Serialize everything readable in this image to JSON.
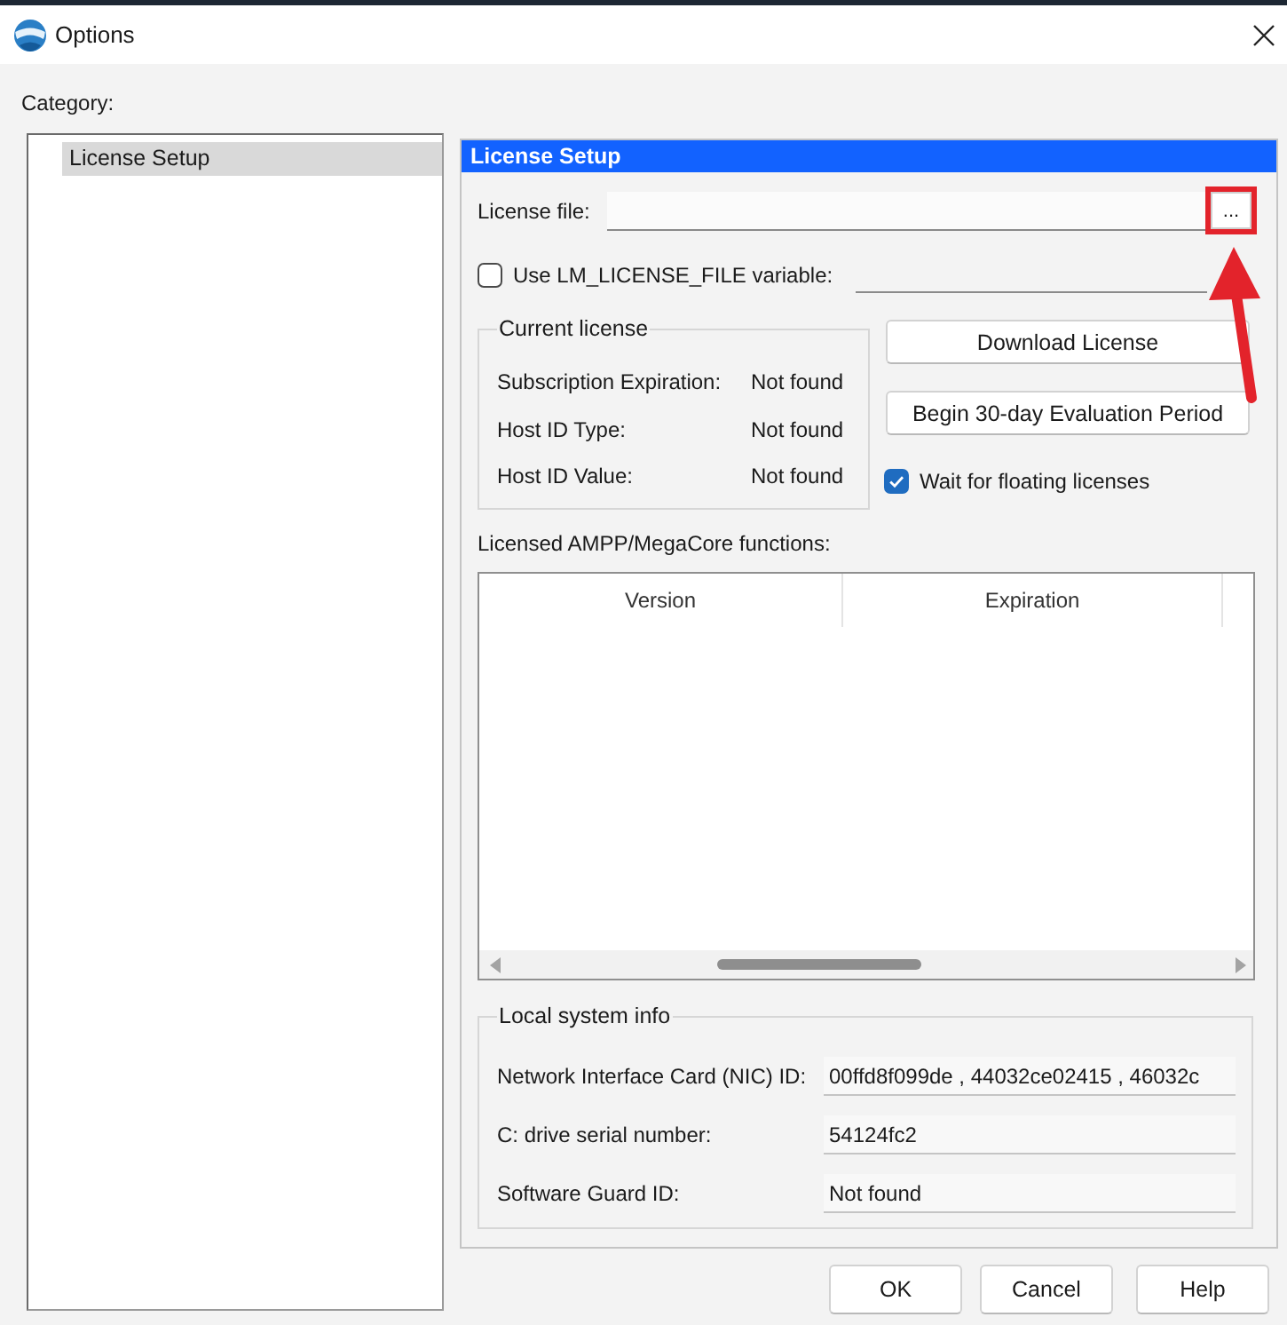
{
  "window": {
    "title": "Options"
  },
  "category": {
    "label": "Category:",
    "items": [
      {
        "label": "License Setup",
        "selected": true
      }
    ]
  },
  "panel": {
    "title": "License Setup"
  },
  "license_file": {
    "label": "License file:",
    "browse_button": {
      "label": "...",
      "highlighted": true
    }
  },
  "lm_license_variable": {
    "label": "Use LM_LICENSE_FILE variable:",
    "checked": false
  },
  "current_license": {
    "title": "Current license",
    "rows": [
      {
        "label": "Subscription Expiration:",
        "value": "Not found"
      },
      {
        "label": "Host ID Type:",
        "value": "Not found"
      },
      {
        "label": "Host ID Value:",
        "value": "Not found"
      }
    ]
  },
  "actions": [
    "Download License",
    "Begin 30-day Evaluation Period"
  ],
  "wait_for_floating": {
    "label": "Wait for floating licenses",
    "checked": true
  },
  "functions": {
    "label": "Licensed AMPP/MegaCore functions:",
    "columns": [
      "Version",
      "Expiration"
    ]
  },
  "local_system_info": {
    "title": "Local system info",
    "rows": [
      {
        "label": "Network Interface Card (NIC) ID:",
        "value": "00ffd8f099de , 44032ce02415 , 46032c"
      },
      {
        "label": "C: drive serial number:",
        "value": "54124fc2"
      },
      {
        "label": "Software Guard ID:",
        "value": "Not found"
      }
    ]
  },
  "buttons": [
    "OK",
    "Cancel",
    "Help"
  ]
}
